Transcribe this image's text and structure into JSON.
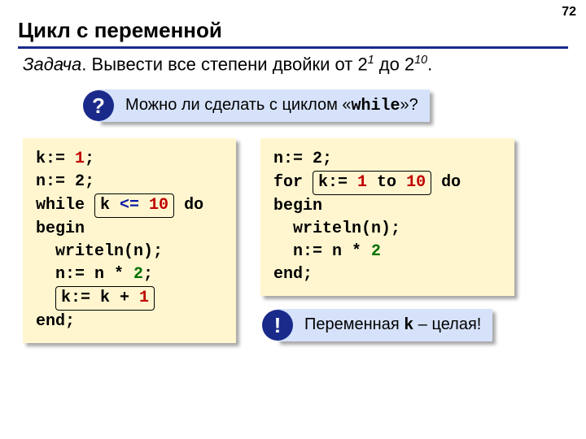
{
  "page_number": "72",
  "title": "Цикл с переменной",
  "task_word": "Задача",
  "task_text_a": ". Вывести все степени двойки от 2",
  "task_sup1": "1",
  "task_mid": " до 2",
  "task_sup2": "10",
  "task_end": ".",
  "callout_q": {
    "badge": "?",
    "text_a": "Можно ли сделать с циклом «",
    "mono": "while",
    "text_b": "»?"
  },
  "callout_ex": {
    "badge": "!",
    "text_a": "Переменная ",
    "mono": "k",
    "text_b": " – целая!"
  },
  "code_left": {
    "l1a": "k:= ",
    "l1b": "1",
    "l1c": ";",
    "l2": "n:= 2;",
    "l3a": "while ",
    "l3_hl_a": "k ",
    "l3_hl_op": "<=",
    "l3_hl_b": " 10",
    "l3b": " do",
    "l4": "begin",
    "l5": "  writeln(n);",
    "l6a": "  n:= n * ",
    "l6b": "2",
    "l6c": ";",
    "l7_indent": "  ",
    "l7_hl_a": "k:= k + ",
    "l7_hl_b": "1",
    "l8": "end;"
  },
  "code_right": {
    "l1": "n:= 2;",
    "l2a": "for ",
    "l2_hl_a": "k:= ",
    "l2_hl_b": "1",
    "l2_hl_c": " to ",
    "l2_hl_d": "10",
    "l2b": " do",
    "l3": "begin",
    "l4": "  writeln(n);",
    "l5a": "  n:= n * ",
    "l5b": "2",
    "l6": "end;"
  }
}
